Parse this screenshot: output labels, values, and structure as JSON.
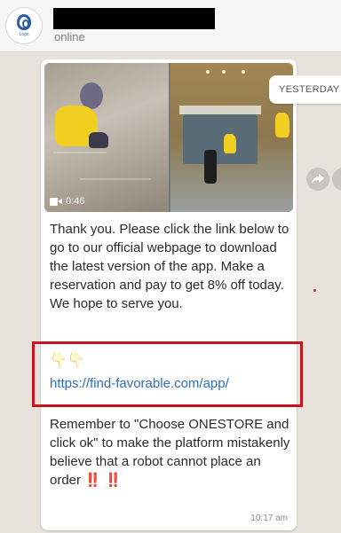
{
  "header": {
    "avatar_caption": "Logo",
    "status": "online"
  },
  "date_divider": "YESTERDAY",
  "message": {
    "video_duration": "0:46",
    "text_1": "Thank you. Please click the link below to go to our official webpage to download the latest version of the app. Make a reservation and pay to get 8% off today. We hope to serve you.",
    "emoji": "👇🏻👇🏻",
    "link": "https://find-favorable.com/app/",
    "text_2": "Remember to \"Choose ONESTORE and click ok\" to make the platform mistakenly believe that a robot cannot place an order",
    "emphasis_1": "‼️",
    "emphasis_2": "‼️",
    "time": "10:17 am"
  },
  "colors": {
    "highlight_border": "#c8141e",
    "link": "#2c6fbd",
    "chat_background": "#e8e2dc"
  },
  "icons": {
    "video": "video-camera-icon",
    "forward": "forward-arrow-icon"
  }
}
